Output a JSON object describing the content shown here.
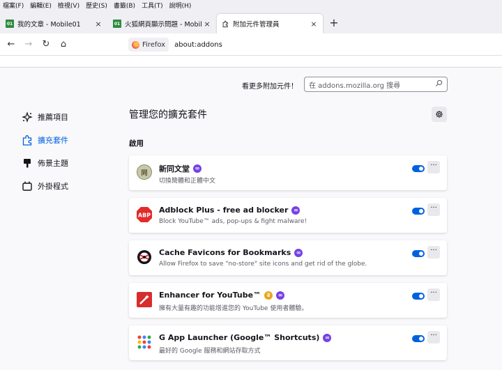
{
  "menubar": [
    "檔案(F)",
    "編輯(E)",
    "檢視(V)",
    "歷史(S)",
    "書籤(B)",
    "工具(T)",
    "說明(H)"
  ],
  "tabs": [
    {
      "label": "我的文章 - Mobile01"
    },
    {
      "label": "火狐網頁顯示問題 - Mobile01"
    },
    {
      "label": "附加元件管理員"
    }
  ],
  "favicon_text": "01",
  "close_glyph": "×",
  "newtab_glyph": "+",
  "nav": {
    "back": "←",
    "forward": "→",
    "reload": "↻",
    "home": "⌂"
  },
  "urlbar": {
    "identity": "Firefox",
    "url": "about:addons"
  },
  "more_addons_text": "看更多附加元件！",
  "search_placeholder": "在 addons.mozilla.org 搜尋",
  "sidebar": [
    {
      "label": "推薦項目",
      "icon": "sparkle-icon"
    },
    {
      "label": "擴充套件",
      "icon": "puzzle-icon"
    },
    {
      "label": "佈景主題",
      "icon": "brush-icon"
    },
    {
      "label": "外掛程式",
      "icon": "plugin-icon"
    }
  ],
  "heading": "管理您的擴充套件",
  "section_enabled": "啟用",
  "more_glyph": "···",
  "addons": [
    {
      "name": "新同文堂",
      "desc": "切換簡體和正體中文",
      "icon_text": "同"
    },
    {
      "name": "Adblock Plus - free ad blocker",
      "desc": "Block YouTube™ ads, pop-ups & fight malware!",
      "icon_text": "ABP"
    },
    {
      "name": "Cache Favicons for Bookmarks",
      "desc": "Allow Firefox to save \"no-store\" site icons and get rid of the globe."
    },
    {
      "name": "Enhancer for YouTube™",
      "desc": "擁有大量有趣的功能增進您的 YouTube 使用者體驗。"
    },
    {
      "name": "G App Launcher (Google™ Shortcuts)",
      "desc": "最好的 Google 服務和網站存取方式"
    }
  ],
  "colors": {
    "accent": "#0061e0",
    "recommended_badge": "#7542e5",
    "abp_red": "#e32a2a"
  }
}
